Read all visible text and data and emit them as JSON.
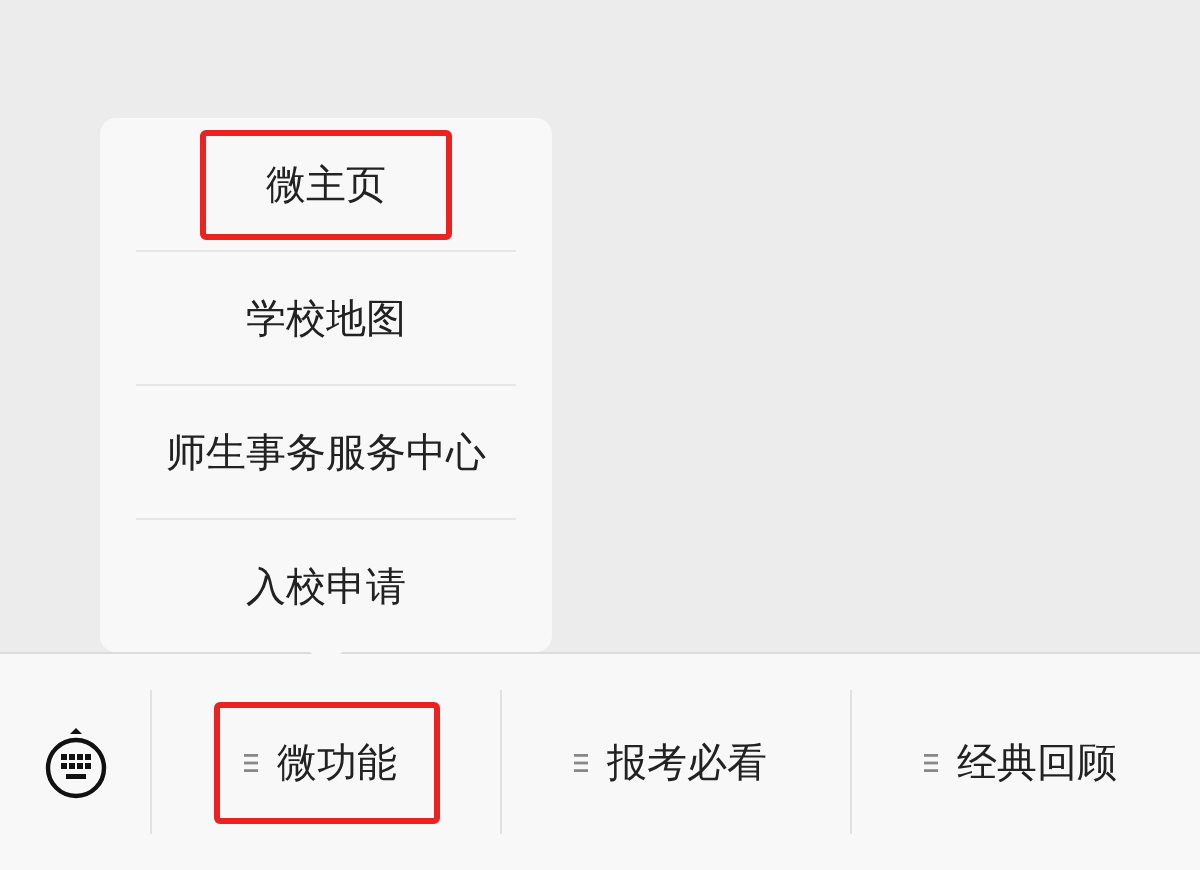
{
  "menu": [
    {
      "label": "微功能",
      "highlighted": true,
      "submenu": [
        {
          "label": "微主页",
          "highlighted": true
        },
        {
          "label": "学校地图",
          "highlighted": false
        },
        {
          "label": "师生事务服务中心",
          "highlighted": false
        },
        {
          "label": "入校申请",
          "highlighted": false
        }
      ]
    },
    {
      "label": "报考必看",
      "highlighted": false
    },
    {
      "label": "经典回顾",
      "highlighted": false
    }
  ]
}
